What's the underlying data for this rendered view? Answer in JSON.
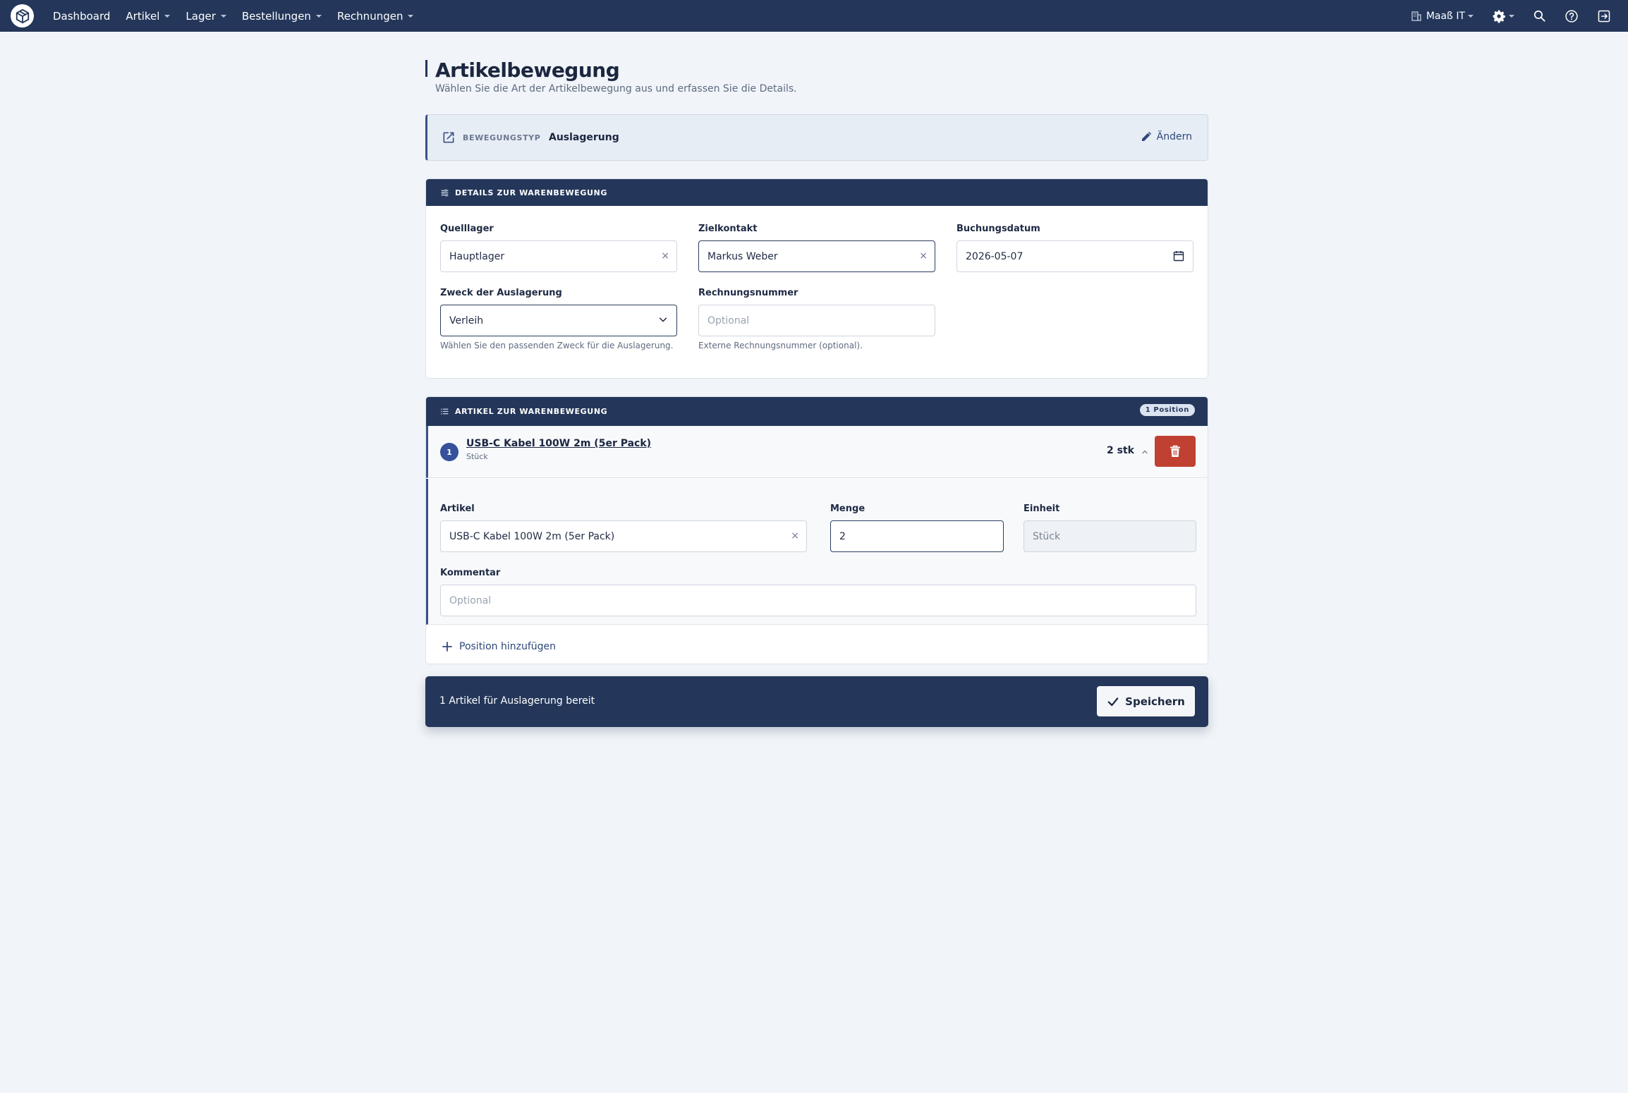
{
  "nav": {
    "items": [
      {
        "label": "Dashboard",
        "has_dropdown": false
      },
      {
        "label": "Artikel",
        "has_dropdown": true
      },
      {
        "label": "Lager",
        "has_dropdown": true
      },
      {
        "label": "Bestellungen",
        "has_dropdown": true
      },
      {
        "label": "Rechnungen",
        "has_dropdown": true
      }
    ],
    "company": "Maaß IT"
  },
  "page": {
    "title": "Artikelbewegung",
    "subtitle": "Wählen Sie die Art der Artikelbewegung aus und erfassen Sie die Details."
  },
  "movement_type": {
    "label": "BEWEGUNGSTYP",
    "value": "Auslagerung",
    "change_label": "Ändern"
  },
  "details": {
    "header": "DETAILS ZUR WARENBEWEGUNG",
    "source_label": "Quelllager",
    "source_value": "Hauptlager",
    "target_label": "Zielkontakt",
    "target_value": "Markus Weber",
    "date_label": "Buchungsdatum",
    "date_value": "2026-05-07",
    "purpose_label": "Zweck der Auslagerung",
    "purpose_value": "Verleih",
    "purpose_help": "Wählen Sie den passenden Zweck für die Auslagerung.",
    "invoice_label": "Rechnungsnummer",
    "invoice_placeholder": "Optional",
    "invoice_help": "Externe Rechnungsnummer (optional)."
  },
  "items": {
    "header": "ARTIKEL ZUR WARENBEWEGUNG",
    "badge": "1 Position",
    "rows": [
      {
        "number": "1",
        "name": "USB-C Kabel 100W 2m (5er Pack)",
        "unit": "Stück",
        "qty": "2 stk",
        "article_label": "Artikel",
        "article_value": "USB-C Kabel 100W 2m (5er Pack)",
        "amount_label": "Menge",
        "amount_value": "2",
        "unit_label": "Einheit",
        "unit_value": "Stück",
        "comment_label": "Kommentar",
        "comment_placeholder": "Optional"
      }
    ],
    "add_label": "Position hinzufügen"
  },
  "footer": {
    "status": "1 Artikel für Auslagerung bereit",
    "save_label": "Speichern"
  },
  "colors": {
    "navy": "#24375a",
    "accent": "#3a5288",
    "danger": "#c04131",
    "background": "#f1f4f8"
  }
}
